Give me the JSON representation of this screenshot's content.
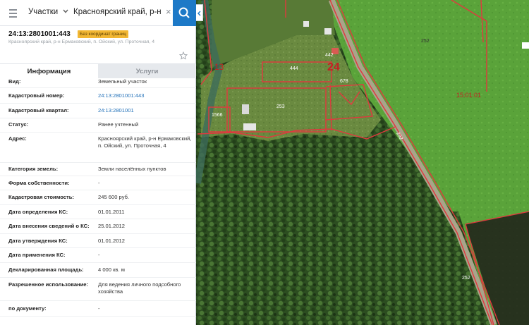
{
  "search": {
    "layer_label": "Участки",
    "query": "Красноярский край, р-н Ерма",
    "clear_symbol": "×"
  },
  "object": {
    "cadastral_number": "24:13:2801001:443",
    "badge": "Без координат границ",
    "address_line": "Красноярский край, р-н Ермаковский, п. Ойский, ул. Проточная, 4"
  },
  "tabs": {
    "info": "Информация",
    "services": "Услуги"
  },
  "fields": [
    {
      "label": "Вид:",
      "value": "Земельный участок",
      "link": false
    },
    {
      "label": "Кадастровый номер:",
      "value": "24:13:2801001:443",
      "link": true
    },
    {
      "label": "Кадастровый квартал:",
      "value": "24:13:2801001",
      "link": true
    },
    {
      "label": "Статус:",
      "value": "Ранее учтенный",
      "link": false
    },
    {
      "label": "Адрес:",
      "value": "Красноярский край, р-н Ермаковский, п. Ойский, ул. Проточная, 4",
      "link": false
    },
    {
      "label": "Категория земель:",
      "value": "Земли населённых пунктов",
      "link": false
    },
    {
      "label": "Форма собственности:",
      "value": "-",
      "link": false
    },
    {
      "label": "Кадастровая стоимость:",
      "value": "245 600 руб.",
      "link": false
    },
    {
      "label": "Дата определения КС:",
      "value": "01.01.2011",
      "link": false
    },
    {
      "label": "Дата внесения сведений о КС:",
      "value": "25.01.2012",
      "link": false
    },
    {
      "label": "Дата утверждения КС:",
      "value": "01.01.2012",
      "link": false
    },
    {
      "label": "Дата применения КС:",
      "value": "-",
      "link": false
    },
    {
      "label": "Декларированная площадь:",
      "value": "4 000 кв. м",
      "link": false
    },
    {
      "label": "Разрешенное использование:",
      "value": "Для ведения личного подсобного хозяйства",
      "link": false
    },
    {
      "label": "по документу:",
      "value": "-",
      "link": false
    }
  ],
  "map": {
    "parcel_labels": [
      "24",
      "13",
      "252",
      "444",
      "442",
      "678",
      "253",
      "1566",
      "15:01:01",
      "232",
      "252"
    ],
    "boundary_color": "#e0393e",
    "field_color": "#4f9a34",
    "forest_color": "#2a4a1f"
  }
}
